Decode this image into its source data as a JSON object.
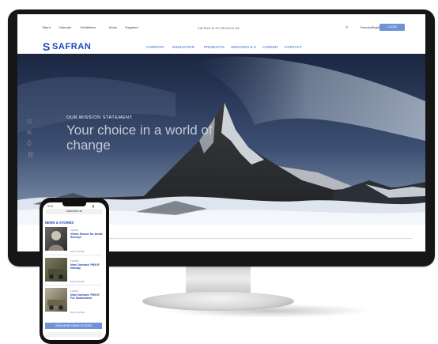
{
  "desktop": {
    "top_links": [
      "Talent",
      "Calendar",
      "Exhibitions",
      "Kiosk",
      "Suppliers"
    ],
    "tagline": "SAFRAN ELECTRONICS AB",
    "language": "Svenska/English",
    "login_label": "LOGIN",
    "logo_text": "SAFRAN",
    "nav_items": [
      "COMPANY",
      "INNOVATION",
      "PRODUCTS",
      "SERVICES & S",
      "CAREER",
      "CONTACT"
    ],
    "hero": {
      "label": "OUR MISSION STATEMENT",
      "title": "Your choice in a world of change"
    }
  },
  "mobile": {
    "time": "9:41",
    "url": "safranelec.se",
    "section_title": "NEWS & STORIES",
    "stories": [
      {
        "date": "01/2021",
        "title": "Vision Sensor for Aerial Surveys",
        "more": "READ MORE"
      },
      {
        "date": "12/2020",
        "title": "New Contract: PMV-R Norway",
        "more": "READ MORE"
      },
      {
        "date": "11/2020",
        "title": "New Contract: PMV-R For Switzerland",
        "more": "READ MORE"
      }
    ],
    "more_button": "VIEW MORE NEWS STORIES"
  },
  "colors": {
    "brand_blue": "#1a47b8",
    "accent_blue": "#6f93d6"
  }
}
